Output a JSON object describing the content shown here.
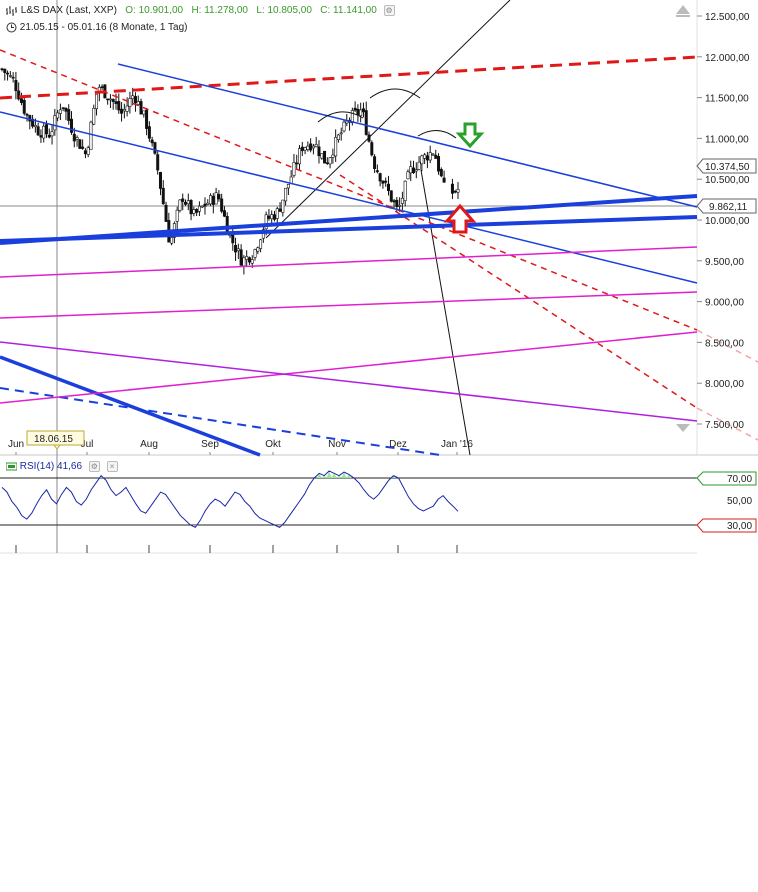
{
  "header": {
    "title": "L&S DAX (Last, XXP)",
    "open": "O: 10.901,00",
    "high": "H: 11.278,00",
    "low": "L: 10.805,00",
    "close": "C: 11.141,00",
    "range": "21.05.15 - 05.01.16 (8 Monate, 1 Tag)",
    "price_icon": "bar-chart-icon",
    "range_icon": "clock-icon"
  },
  "rsi_header": {
    "name": "RSI(14)",
    "value": "41,66"
  },
  "colors": {
    "bull": "#111111",
    "blue_trend": "#1a3fdc",
    "red_trend": "#e01818",
    "magenta": "#e020d0",
    "purple": "#b020e0",
    "rsi": "#1b28a5",
    "green_arrow": "#2aa02a",
    "red_arrow": "#e01818"
  },
  "chart_data": [
    {
      "type": "candlestick",
      "title": "L&S DAX (Last, XXP)",
      "y_ticks": [
        "12.500,00",
        "12.000,00",
        "11.500,00",
        "11.000,00",
        "10.500,00",
        "10.000,00",
        "9.500,00",
        "9.000,00",
        "8.500,00",
        "8.000,00",
        "7.500,00"
      ],
      "x_ticks": [
        "Jun",
        "Jul",
        "Aug",
        "Sep",
        "Okt",
        "Nov",
        "Dez",
        "Jan '16"
      ],
      "ylim": [
        7400,
        12800
      ],
      "last_price_label": "10.374,50",
      "crosshair_price_label": "9.862,11",
      "crosshair_date_label": "18.06.15",
      "close_series_sketch": [
        [
          "21.05.15",
          11850
        ],
        [
          "28.05.15",
          11700
        ],
        [
          "04.06.15",
          11300
        ],
        [
          "11.06.15",
          11100
        ],
        [
          "18.06.15",
          11050
        ],
        [
          "25.06.15",
          11450
        ],
        [
          "02.07.15",
          11050
        ],
        [
          "09.07.15",
          10800
        ],
        [
          "16.07.15",
          11650
        ],
        [
          "23.07.15",
          11500
        ],
        [
          "30.07.15",
          11300
        ],
        [
          "06.08.15",
          11550
        ],
        [
          "13.08.15",
          11200
        ],
        [
          "20.08.15",
          10600
        ],
        [
          "24.08.15",
          9700
        ],
        [
          "27.08.15",
          10300
        ],
        [
          "03.09.15",
          10050
        ],
        [
          "10.09.15",
          10200
        ],
        [
          "17.09.15",
          10300
        ],
        [
          "24.09.15",
          9800
        ],
        [
          "29.09.15",
          9500
        ],
        [
          "02.10.15",
          9600
        ],
        [
          "09.10.15",
          10000
        ],
        [
          "16.10.15",
          10100
        ],
        [
          "23.10.15",
          10500
        ],
        [
          "30.10.15",
          10900
        ],
        [
          "06.11.15",
          10950
        ],
        [
          "13.11.15",
          10700
        ],
        [
          "20.11.15",
          11000
        ],
        [
          "27.11.15",
          11250
        ],
        [
          "02.12.15",
          11350
        ],
        [
          "04.12.15",
          10700
        ],
        [
          "11.12.15",
          10400
        ],
        [
          "15.12.15",
          10100
        ],
        [
          "18.12.15",
          10600
        ],
        [
          "23.12.15",
          10750
        ],
        [
          "30.12.15",
          10850
        ],
        [
          "04.01.16",
          10300
        ],
        [
          "05.01.16",
          10374.5
        ]
      ]
    },
    {
      "type": "line",
      "title": "RSI(14)",
      "current": 41.66,
      "y_ticks": [
        "70,00",
        "50,00",
        "30,00"
      ],
      "levels": [
        70,
        30
      ],
      "ylim": [
        20,
        80
      ]
    }
  ]
}
